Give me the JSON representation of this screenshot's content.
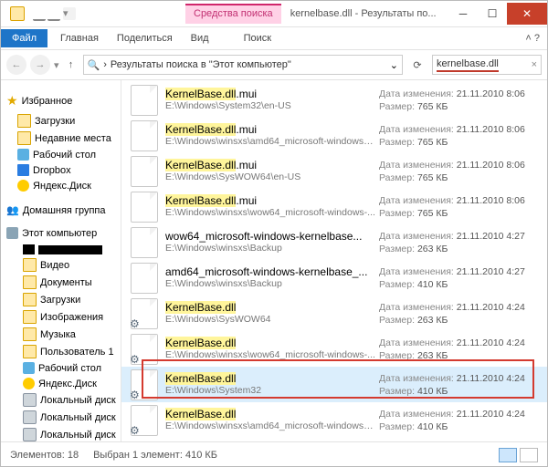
{
  "title": "kernelbase.dll - Результаты по...",
  "context_tab": "Средства поиска",
  "ribbon": {
    "file": "Файл",
    "tabs": [
      "Главная",
      "Поделиться",
      "Вид",
      "Поиск"
    ]
  },
  "addr": {
    "label": "Результаты поиска в \"Этот компьютер\""
  },
  "search": {
    "query": "kernelbase.dll"
  },
  "tree": {
    "fav_header": "Избранное",
    "fav": [
      "Загрузки",
      "Недавние места",
      "Рабочий стол",
      "Dropbox",
      "Яндекс.Диск"
    ],
    "homegroup": "Домашняя группа",
    "this_pc": "Этот компьютер",
    "pc": [
      "Видео",
      "Документы",
      "Загрузки",
      "Изображения",
      "Музыка",
      "Пользователь 1",
      "Рабочий стол",
      "Яндекс.Диск",
      "Локальный диск",
      "Локальный диск",
      "Локальный диск"
    ]
  },
  "meta_labels": {
    "date": "Дата изменения:",
    "size": "Размер:"
  },
  "files": [
    {
      "name": "KernelBase.dll",
      "ext": ".mui",
      "path": "E:\\Windows\\System32\\en-US",
      "date": "21.11.2010 8:06",
      "size": "765 КБ",
      "hl": true,
      "gear": false
    },
    {
      "name": "KernelBase.dll",
      "ext": ".mui",
      "path": "E:\\Windows\\winsxs\\amd64_microsoft-windows-k...",
      "date": "21.11.2010 8:06",
      "size": "765 КБ",
      "hl": true,
      "gear": false
    },
    {
      "name": "KernelBase.dll",
      "ext": ".mui",
      "path": "E:\\Windows\\SysWOW64\\en-US",
      "date": "21.11.2010 8:06",
      "size": "765 КБ",
      "hl": true,
      "gear": false
    },
    {
      "name": "KernelBase.dll",
      "ext": ".mui",
      "path": "E:\\Windows\\winsxs\\wow64_microsoft-windows-...",
      "date": "21.11.2010 8:06",
      "size": "765 КБ",
      "hl": true,
      "gear": false
    },
    {
      "name": "wow64_microsoft-windows-kernelbase...",
      "ext": "",
      "path": "E:\\Windows\\winsxs\\Backup",
      "date": "21.11.2010 4:27",
      "size": "263 КБ",
      "hl": false,
      "gear": false
    },
    {
      "name": "amd64_microsoft-windows-kernelbase_...",
      "ext": "",
      "path": "E:\\Windows\\winsxs\\Backup",
      "date": "21.11.2010 4:27",
      "size": "410 КБ",
      "hl": false,
      "gear": false
    },
    {
      "name": "KernelBase.dll",
      "ext": "",
      "path": "E:\\Windows\\SysWOW64",
      "date": "21.11.2010 4:24",
      "size": "263 КБ",
      "hl": true,
      "gear": true
    },
    {
      "name": "KernelBase.dll",
      "ext": "",
      "path": "E:\\Windows\\winsxs\\wow64_microsoft-windows-...",
      "date": "21.11.2010 4:24",
      "size": "263 КБ",
      "hl": true,
      "gear": true
    },
    {
      "name": "KernelBase.dll",
      "ext": "",
      "path": "E:\\Windows\\System32",
      "date": "21.11.2010 4:24",
      "size": "410 КБ",
      "hl": true,
      "gear": true,
      "sel": true
    },
    {
      "name": "KernelBase.dll",
      "ext": "",
      "path": "E:\\Windows\\winsxs\\amd64_microsoft-windows-k...",
      "date": "21.11.2010 4:24",
      "size": "410 КБ",
      "hl": true,
      "gear": true
    }
  ],
  "status": {
    "count": "Элементов: 18",
    "sel": "Выбран 1 элемент: 410 КБ"
  }
}
